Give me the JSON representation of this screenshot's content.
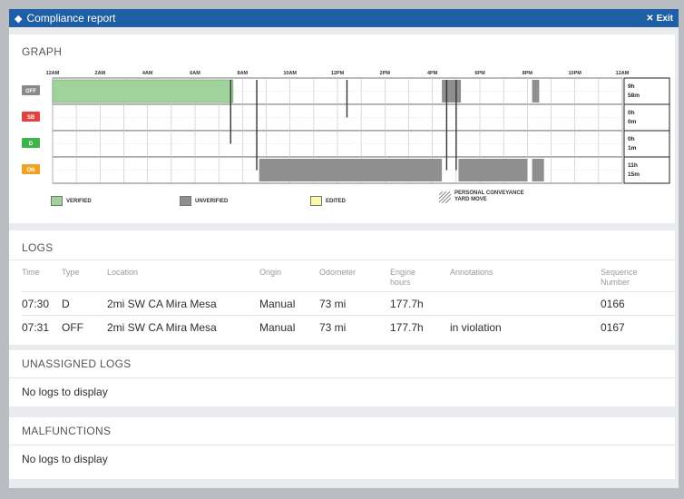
{
  "titlebar": {
    "title": "Compliance report",
    "exit_label": "Exit"
  },
  "graph": {
    "section_title": "GRAPH",
    "time_labels": [
      "12AM",
      "2AM",
      "4AM",
      "6AM",
      "8AM",
      "10AM",
      "12PM",
      "2PM",
      "4PM",
      "6PM",
      "8PM",
      "10PM",
      "12AM"
    ],
    "statuses": [
      {
        "label": "OFF",
        "color": "#8a8a8a",
        "total": [
          "9h",
          "58m"
        ]
      },
      {
        "label": "SB",
        "color": "#e0443c",
        "total": [
          "0h",
          "0m"
        ]
      },
      {
        "label": "D",
        "color": "#3db54a",
        "total": [
          "0h",
          "1m"
        ]
      },
      {
        "label": "ON",
        "color": "#f0a224",
        "total": [
          "11h",
          "15m"
        ]
      }
    ],
    "legend": {
      "verified": "VERIFIED",
      "unverified": "UNVERIFIED",
      "edited": "EDITED",
      "personal_conveyance": "PERSONAL CONVEYANCE",
      "yard_move": "YARD MOVE"
    },
    "colors": {
      "verified": "#9fd39b",
      "unverified": "#8f8f8f",
      "edited": "#fff7a8"
    }
  },
  "logs": {
    "section_title": "LOGS",
    "headers": {
      "time": "Time",
      "type": "Type",
      "location": "Location",
      "origin": "Origin",
      "odometer": "Odometer",
      "engine_hours": [
        "Engine",
        "hours"
      ],
      "annotations": "Annotations",
      "sequence": [
        "Sequence",
        "Number"
      ]
    },
    "rows": [
      {
        "time": "07:30",
        "type": "D",
        "location": "2mi SW CA Mira Mesa",
        "origin": "Manual",
        "odometer": "73 mi",
        "engine_hours": "177.7h",
        "annotations": "",
        "sequence": "0166"
      },
      {
        "time": "07:31",
        "type": "OFF",
        "location": "2mi SW CA Mira Mesa",
        "origin": "Manual",
        "odometer": "73 mi",
        "engine_hours": "177.7h",
        "annotations": "in violation",
        "sequence": "0167"
      }
    ]
  },
  "unassigned": {
    "section_title": "UNASSIGNED LOGS",
    "empty_text": "No logs to display"
  },
  "malfunctions": {
    "section_title": "MALFUNCTIONS",
    "empty_text": "No logs to display"
  }
}
